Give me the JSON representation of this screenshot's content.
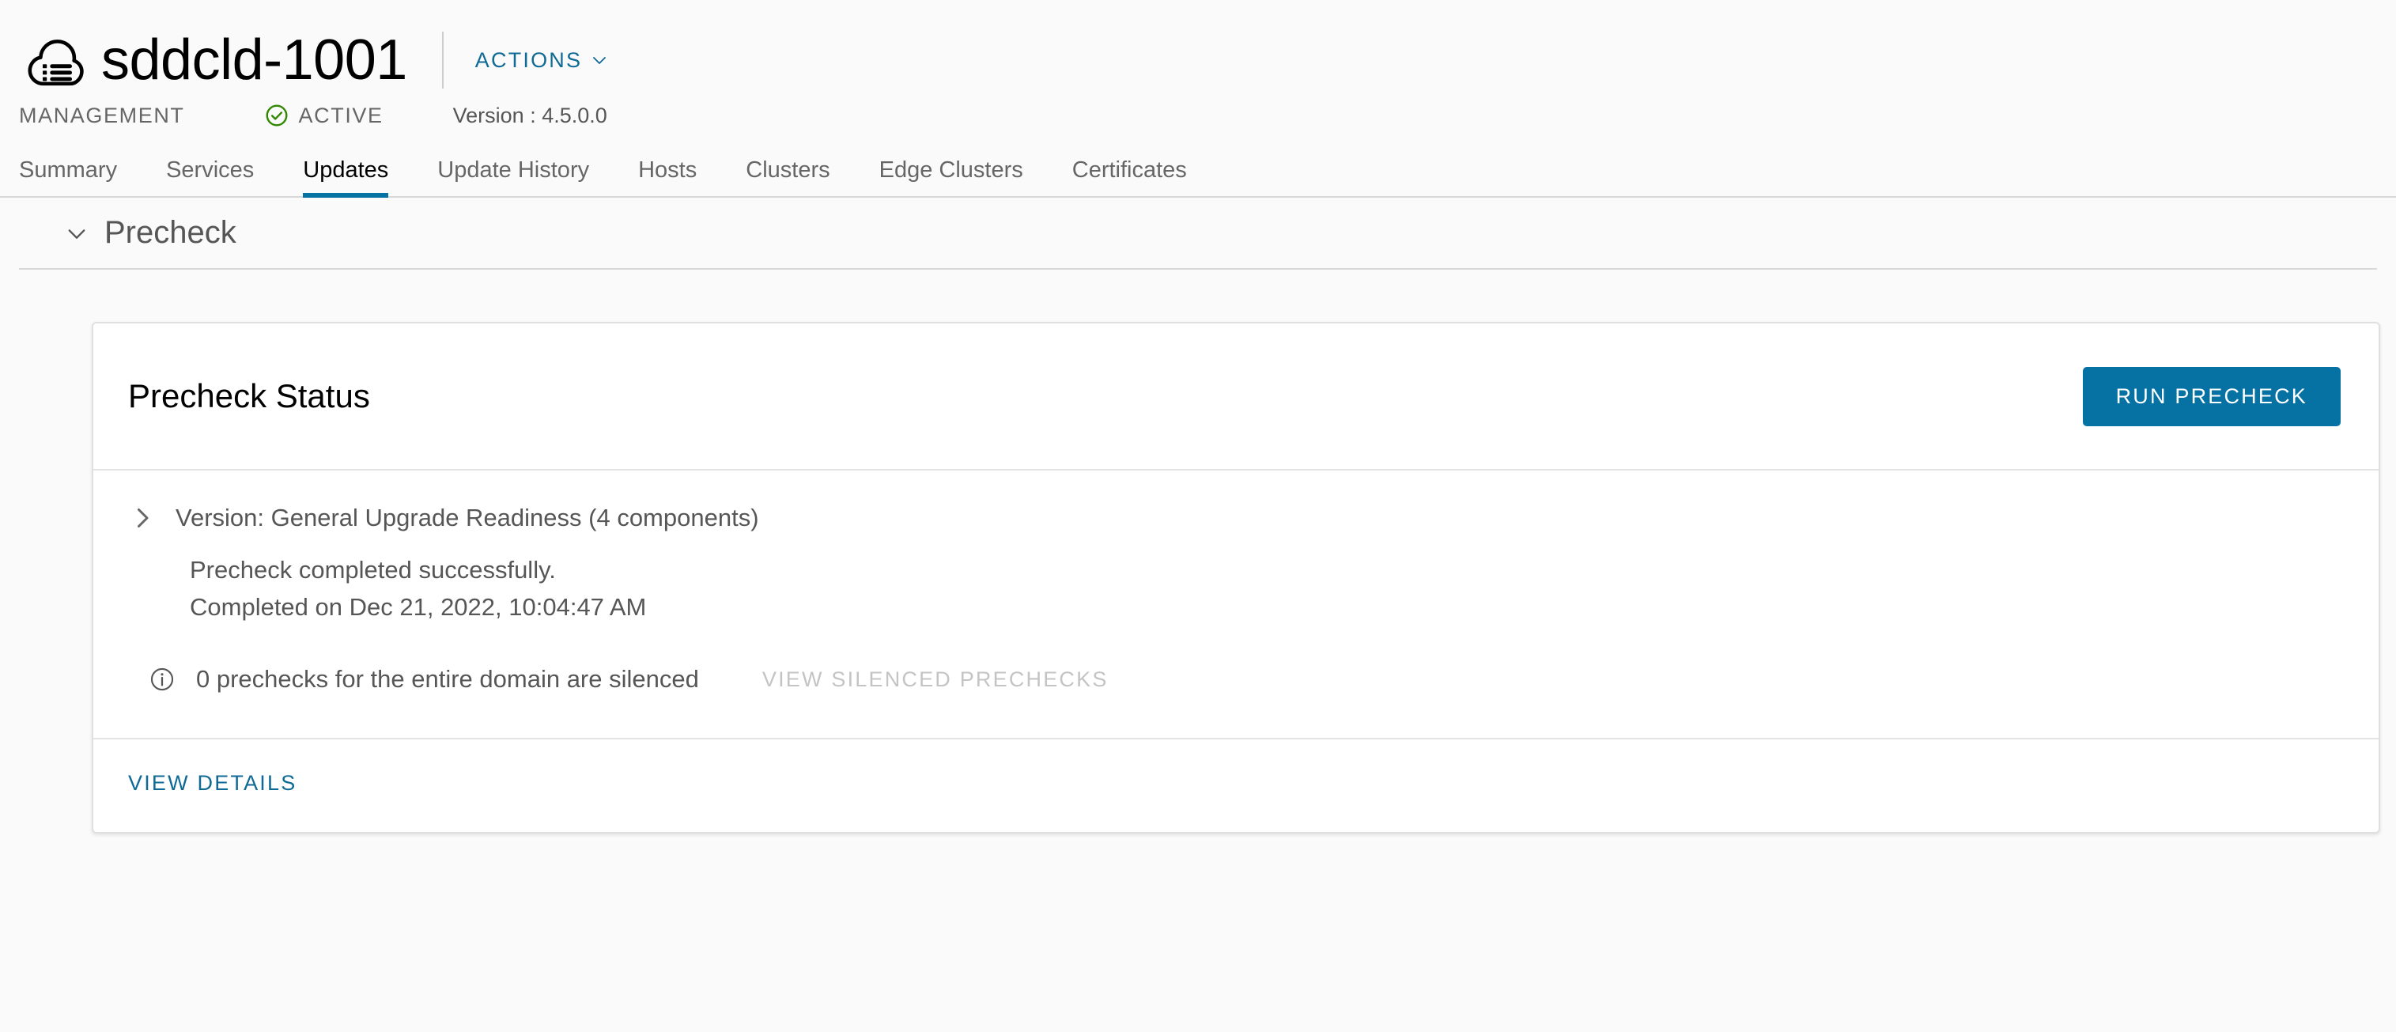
{
  "header": {
    "icon": "cloud-domain-icon",
    "title": "sddcld-1001",
    "actions_label": "ACTIONS",
    "actions_caret": "chevron-down-icon"
  },
  "meta": {
    "domain_type": "MANAGEMENT",
    "status_icon": "success-check-circle-icon",
    "status": "ACTIVE",
    "version": "Version : 4.5.0.0"
  },
  "tabs": [
    {
      "label": "Summary",
      "active": false
    },
    {
      "label": "Services",
      "active": false
    },
    {
      "label": "Updates",
      "active": true
    },
    {
      "label": "Update History",
      "active": false
    },
    {
      "label": "Hosts",
      "active": false
    },
    {
      "label": "Clusters",
      "active": false
    },
    {
      "label": "Edge Clusters",
      "active": false
    },
    {
      "label": "Certificates",
      "active": false
    }
  ],
  "section": {
    "toggle_icon": "chevron-down-icon",
    "title": "Precheck"
  },
  "card": {
    "title": "Precheck Status",
    "run_button": "RUN PRECHECK",
    "readiness": {
      "toggle_icon": "chevron-right-icon",
      "text": "Version: General Upgrade Readiness (4 components)"
    },
    "result_status": "Precheck completed successfully.",
    "result_completed": "Completed on Dec 21, 2022, 10:04:47 AM",
    "silenced": {
      "icon": "info-circle-icon",
      "text": "0 prechecks for the entire domain are silenced",
      "link": "VIEW SILENCED PRECHECKS"
    },
    "footer_link": "VIEW DETAILS"
  },
  "colors": {
    "accent_blue": "#0672a4",
    "link_blue": "#0f6a96",
    "success_green": "#318700",
    "text_gray": "#565656",
    "disabled_gray": "#c4c4c4",
    "page_bg": "#fafafa"
  }
}
